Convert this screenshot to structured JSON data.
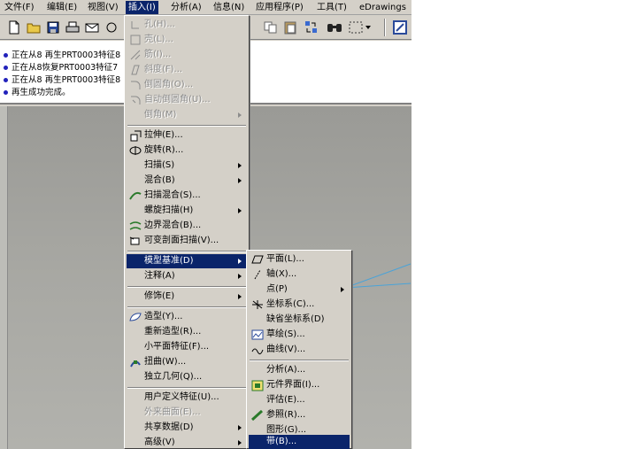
{
  "menubar": {
    "items": [
      "文件(F)",
      "编辑(E)",
      "视图(V)",
      "插入(I)",
      "分析(A)",
      "信息(N)",
      "应用程序(P)",
      "工具(T)",
      "eDrawings"
    ]
  },
  "messages": [
    "正在从8 再生PRT0003特征8",
    "正在从8恢复PRT0003特征7",
    "正在从8 再生PRT0003特征8",
    "再生成功完成。"
  ],
  "insert_menu": {
    "items": [
      {
        "label": "孔(H)...",
        "icon": "hole-icon",
        "disabled": true
      },
      {
        "label": "壳(L)...",
        "icon": "shell-icon",
        "disabled": true
      },
      {
        "label": "筋(I)...",
        "icon": "rib-icon",
        "disabled": true
      },
      {
        "label": "斜度(F)...",
        "icon": "draft-icon",
        "disabled": true
      },
      {
        "label": "倒圆角(O)...",
        "icon": "round-icon",
        "disabled": true
      },
      {
        "label": "自动倒圆角(U)...",
        "icon": "auto-round-icon",
        "disabled": true
      },
      {
        "label": "倒角(M)",
        "icon": "",
        "disabled": true,
        "submenu": true
      },
      {
        "label": "拉伸(E)...",
        "icon": "extrude-icon"
      },
      {
        "label": "旋转(R)...",
        "icon": "revolve-icon"
      },
      {
        "label": "扫描(S)",
        "icon": "",
        "submenu": true
      },
      {
        "label": "混合(B)",
        "icon": "",
        "submenu": true
      },
      {
        "label": "扫描混合(S)...",
        "icon": "swept-blend-icon"
      },
      {
        "label": "螺旋扫描(H)",
        "icon": "",
        "submenu": true
      },
      {
        "label": "边界混合(B)...",
        "icon": "boundary-blend-icon"
      },
      {
        "label": "可变剖面扫描(V)...",
        "icon": "variable-sweep-icon"
      },
      {
        "label": "模型基准(D)",
        "icon": "",
        "submenu": true,
        "highlighted": true
      },
      {
        "label": "注释(A)",
        "icon": "",
        "submenu": true
      },
      {
        "label": "修饰(E)",
        "icon": "",
        "submenu": true
      },
      {
        "label": "造型(Y)...",
        "icon": "style-icon"
      },
      {
        "label": "重新造型(R)...",
        "icon": ""
      },
      {
        "label": "小平面特征(F)...",
        "icon": ""
      },
      {
        "label": "扭曲(W)...",
        "icon": "warp-icon"
      },
      {
        "label": "独立几何(Q)...",
        "icon": ""
      },
      {
        "label": "用户定义特征(U)...",
        "icon": ""
      },
      {
        "label": "外来曲面(E)...",
        "icon": "",
        "disabled": true
      },
      {
        "label": "共享数据(D)",
        "icon": "",
        "submenu": true
      },
      {
        "label": "高级(V)",
        "icon": "",
        "submenu": true
      }
    ]
  },
  "datum_submenu": {
    "items": [
      {
        "label": "平面(L)...",
        "icon": "plane-icon"
      },
      {
        "label": "轴(X)...",
        "icon": "axis-icon"
      },
      {
        "label": "点(P)",
        "icon": "",
        "submenu": true
      },
      {
        "label": "坐标系(C)...",
        "icon": "csys-icon"
      },
      {
        "label": "缺省坐标系(D)",
        "icon": ""
      },
      {
        "label": "草绘(S)...",
        "icon": "sketch-icon"
      },
      {
        "label": "曲线(V)...",
        "icon": "curve-icon"
      },
      {
        "label": "分析(A)...",
        "icon": ""
      },
      {
        "label": "元件界面(I)...",
        "icon": "component-interface-icon"
      },
      {
        "label": "评估(E)...",
        "icon": ""
      },
      {
        "label": "参照(R)...",
        "icon": "reference-icon"
      },
      {
        "label": "图形(G)...",
        "icon": ""
      },
      {
        "label": "带(B)...",
        "icon": "",
        "highlighted": true
      }
    ]
  }
}
